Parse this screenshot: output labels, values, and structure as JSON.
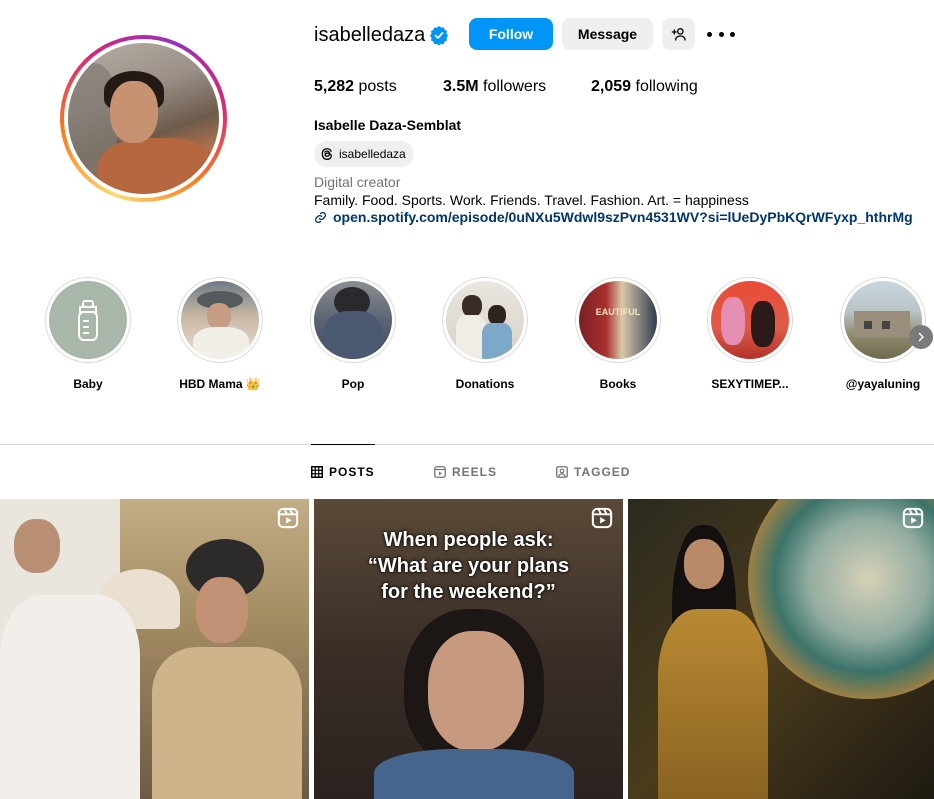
{
  "profile": {
    "username": "isabelledaza",
    "full_name": "Isabelle Daza-Semblat",
    "threads_handle": "isabelledaza",
    "category": "Digital creator",
    "bio": "Family. Food. Sports. Work. Friends. Travel. Fashion. Art. = happiness",
    "link": "open.spotify.com/episode/0uNXu5Wdwl9szPvn4531WV?si=lUeDyPbKQrWFyxp_hthrMg"
  },
  "actions": {
    "follow_label": "Follow",
    "message_label": "Message"
  },
  "stats": {
    "posts_count": "5,282",
    "posts_label": " posts",
    "followers_count": "3.5M",
    "followers_label": " followers",
    "following_count": "2,059",
    "following_label": " following"
  },
  "highlights": [
    {
      "label": "Baby"
    },
    {
      "label": "HBD Mama 👑"
    },
    {
      "label": "Pop"
    },
    {
      "label": "Donations"
    },
    {
      "label": "Books"
    },
    {
      "label": "SEXYTIMEP..."
    },
    {
      "label": "@yayaluning"
    }
  ],
  "tabs": [
    {
      "label": "POSTS",
      "active": true
    },
    {
      "label": "REELS",
      "active": false
    },
    {
      "label": "TAGGED",
      "active": false
    }
  ],
  "posts": [
    {
      "type": "reel",
      "overlay": ""
    },
    {
      "type": "reel",
      "overlay_lines": [
        "When people ask:",
        "“What are your plans",
        "for the weekend?”"
      ]
    },
    {
      "type": "reel",
      "overlay": ""
    }
  ],
  "colors": {
    "follow_blue": "#0095f6",
    "link_blue": "#00376b",
    "verified_blue": "#0095f6",
    "secondary_text": "#737373",
    "button_gray": "#efefef"
  },
  "icons": {
    "verified": "verified-badge-icon",
    "add_user": "add-user-icon",
    "more": "more-horizontal-icon",
    "threads": "threads-icon",
    "link": "link-chain-icon",
    "posts_tab": "grid-icon",
    "reels_tab": "reels-icon",
    "tagged_tab": "tagged-icon",
    "reel_badge": "reel-icon",
    "next": "chevron-right-icon"
  }
}
